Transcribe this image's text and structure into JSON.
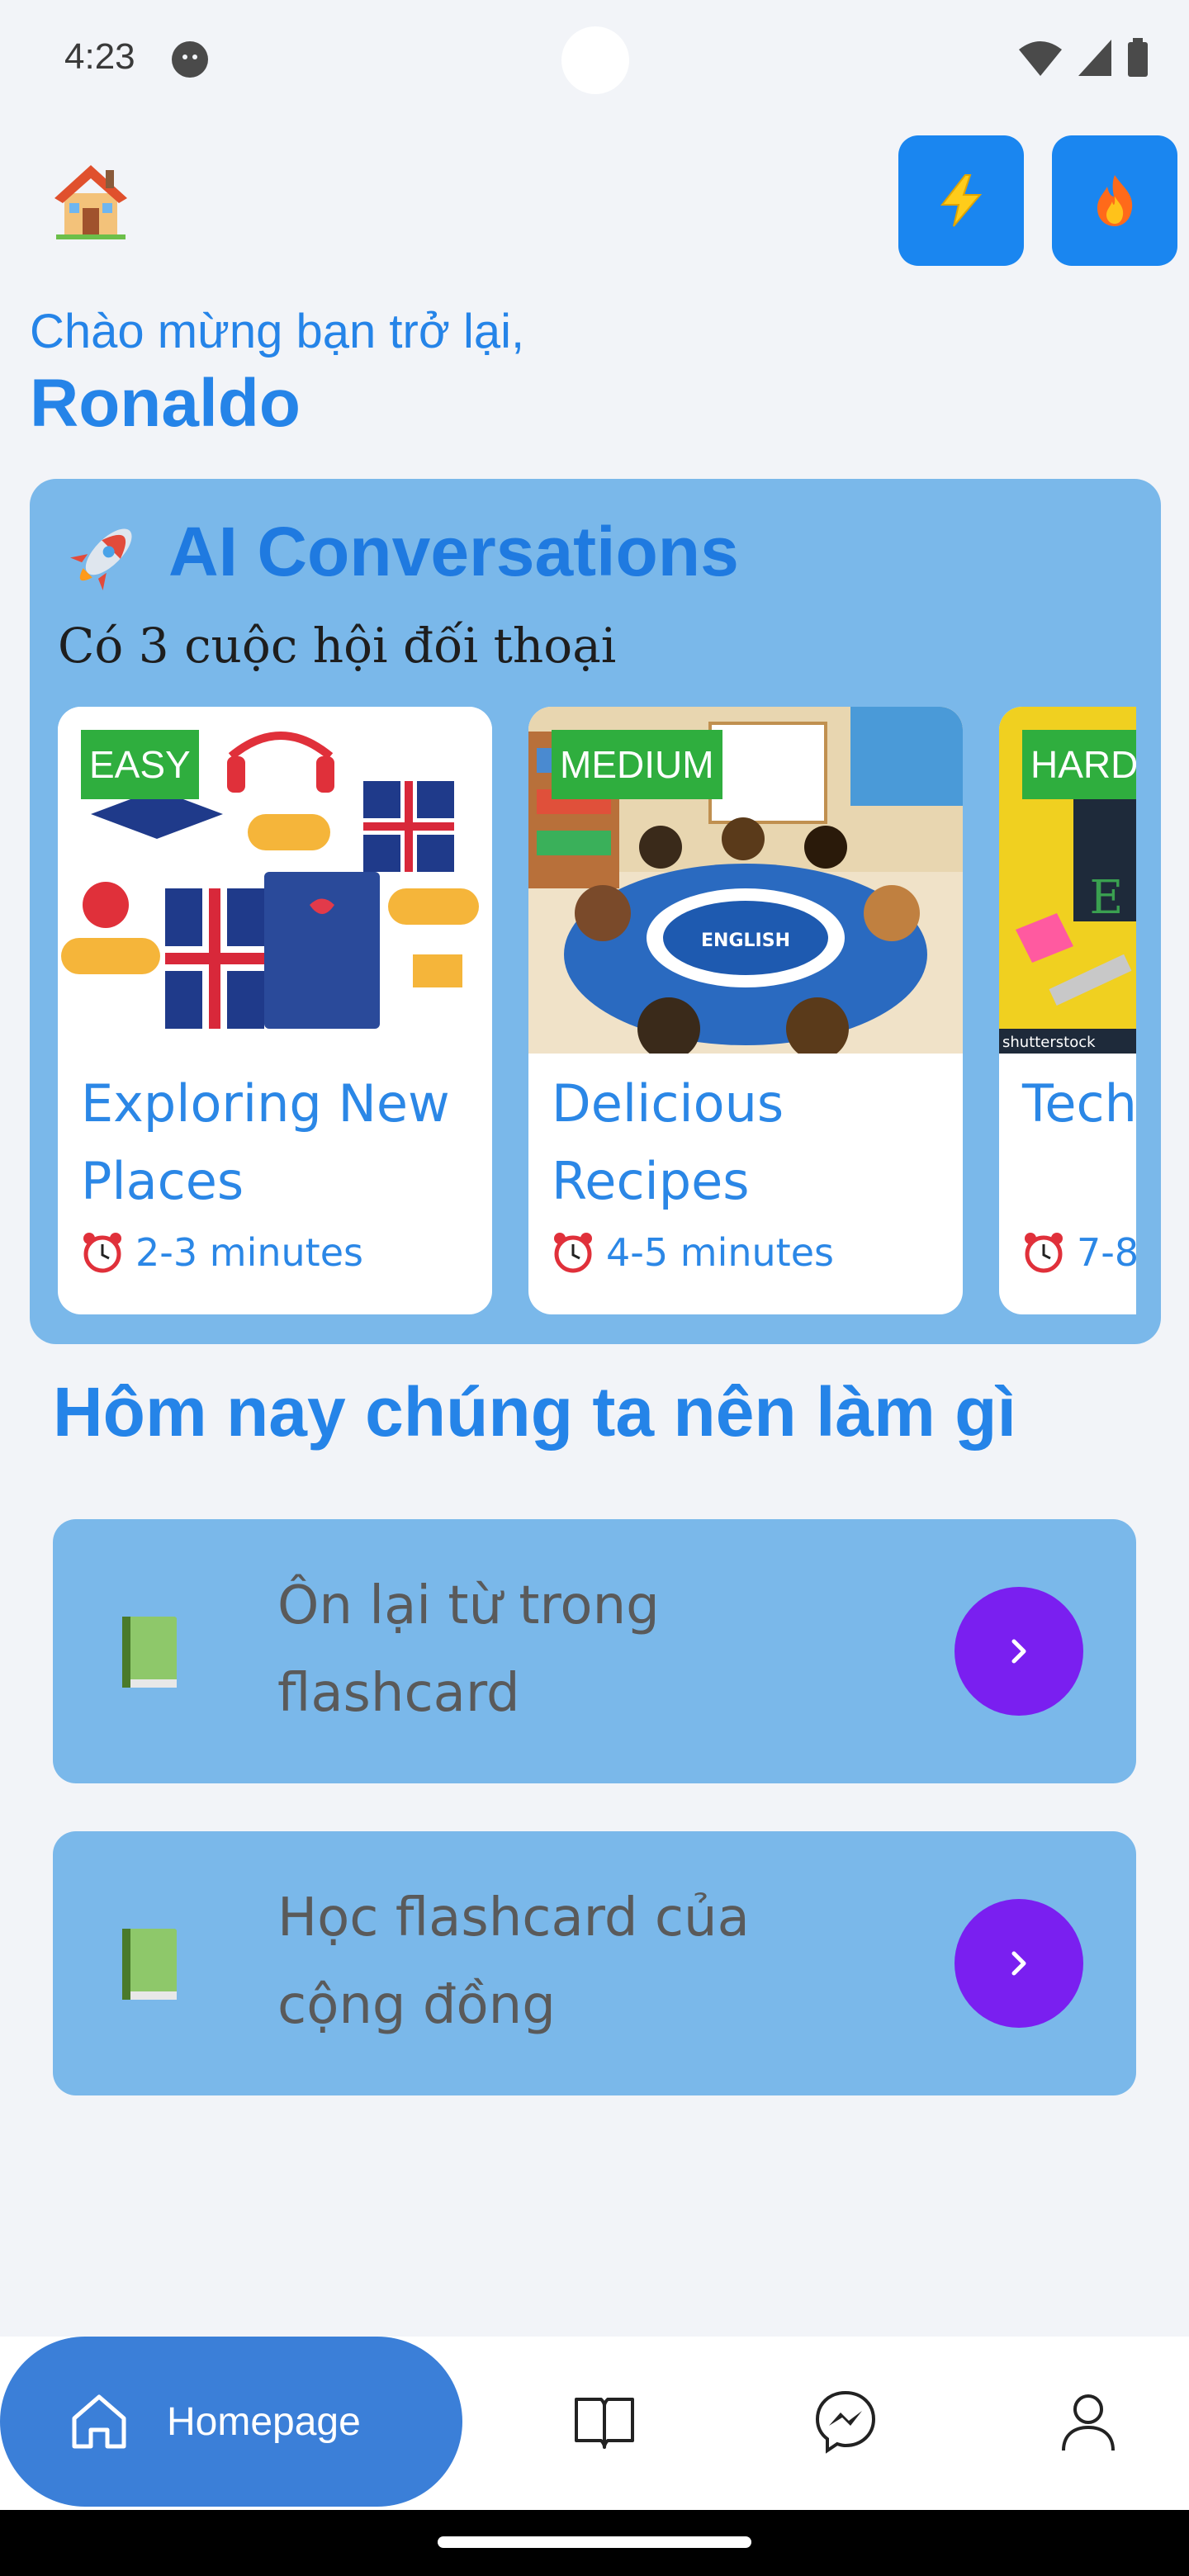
{
  "status_bar": {
    "time": "4:23"
  },
  "header": {
    "home_icon": "house-emoji",
    "buttons": [
      {
        "icon": "lightning-bolt"
      },
      {
        "icon": "fire"
      }
    ],
    "accent_color": "#1a86f0"
  },
  "greeting": {
    "line": "Chào mừng bạn trở lại,",
    "name": "Ronaldo"
  },
  "ai_conversations": {
    "title": "AI Conversations",
    "subtitle": "Có 3 cuộc hội đối thoại",
    "cards": [
      {
        "difficulty": "EASY",
        "title": "Exploring New Places",
        "time": "2-3 minutes"
      },
      {
        "difficulty": "MEDIUM",
        "title": "Delicious Recipes",
        "time": "4-5 minutes"
      },
      {
        "difficulty": "HARD",
        "title": "Tech",
        "time": "7-8"
      }
    ]
  },
  "today": {
    "title": "Hôm nay chúng ta nên làm gì",
    "tasks": [
      {
        "label": "Ôn lại từ trong flashcard"
      },
      {
        "label": "Học flashcard của cộng đồng"
      }
    ]
  },
  "bottom_nav": {
    "active_label": "Homepage",
    "items": [
      "home-icon",
      "book-icon",
      "messenger-icon",
      "profile-icon"
    ]
  }
}
